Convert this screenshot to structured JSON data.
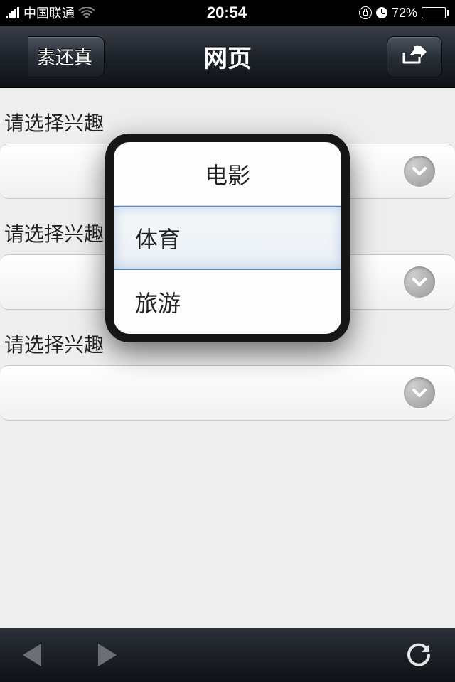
{
  "statusbar": {
    "carrier": "中国联通",
    "time": "20:54",
    "battery_pct": "72%"
  },
  "navbar": {
    "back_label": "素还真",
    "title": "网页"
  },
  "form": {
    "fields": [
      {
        "label": "请选择兴趣"
      },
      {
        "label": "请选择兴趣"
      },
      {
        "label": "请选择兴趣"
      }
    ]
  },
  "picker": {
    "options": [
      {
        "label": "电影"
      },
      {
        "label": "体育"
      },
      {
        "label": "旅游"
      }
    ],
    "selected_index": 1
  }
}
